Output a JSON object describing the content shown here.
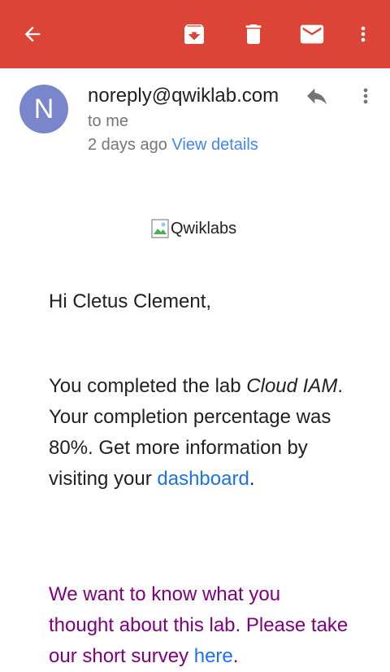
{
  "toolbar": {
    "back_icon": "arrow-back-icon",
    "archive_icon": "archive-icon",
    "delete_icon": "delete-icon",
    "mark_unread_icon": "mail-icon",
    "more_icon": "more-vert-icon",
    "color": "#db4437"
  },
  "header": {
    "avatar_letter": "N",
    "avatar_color": "#7986cb",
    "sender": "noreply@qwiklab.com",
    "recipient": "to me",
    "time": "2 days ago",
    "view_details": "View details"
  },
  "email": {
    "logo_alt": "Qwiklabs",
    "greeting": "Hi Cletus Clement,",
    "p1_part1": "You completed the lab ",
    "p1_lab_name": "Cloud IAM",
    "p1_part2": ". Your completion percentage was 80%. Get more information by visiting your ",
    "p1_link": "dashboard",
    "p1_end": ".",
    "survey_text": "We want to know what you thought about this lab. Please take our short survey ",
    "survey_link": "here",
    "survey_end": "."
  }
}
